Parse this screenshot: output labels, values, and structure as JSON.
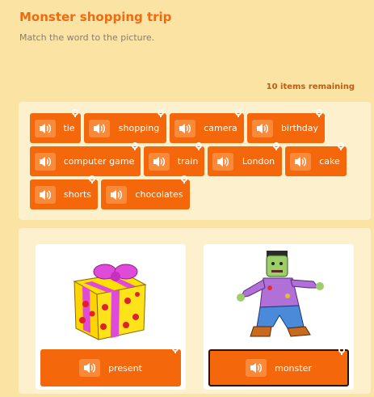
{
  "header": {
    "title": "Monster shopping trip",
    "instructions": "Match the word to the picture."
  },
  "status": {
    "remaining": "10 items remaining"
  },
  "word_bank": {
    "items": [
      {
        "label": "tie"
      },
      {
        "label": "shopping"
      },
      {
        "label": "camera"
      },
      {
        "label": "birthday"
      },
      {
        "label": "computer game"
      },
      {
        "label": "train"
      },
      {
        "label": "London"
      },
      {
        "label": "cake"
      },
      {
        "label": "shorts"
      },
      {
        "label": "chocolates"
      }
    ]
  },
  "cards": [
    {
      "picture": "gift-box-with-bow",
      "answer": "present"
    },
    {
      "picture": "zombie-monster",
      "answer": "monster",
      "selected": true
    }
  ],
  "colors": {
    "background": "#fbe3a4",
    "panel": "#fdf0cc",
    "chip": "#f4670a",
    "title": "#f26a0f"
  }
}
